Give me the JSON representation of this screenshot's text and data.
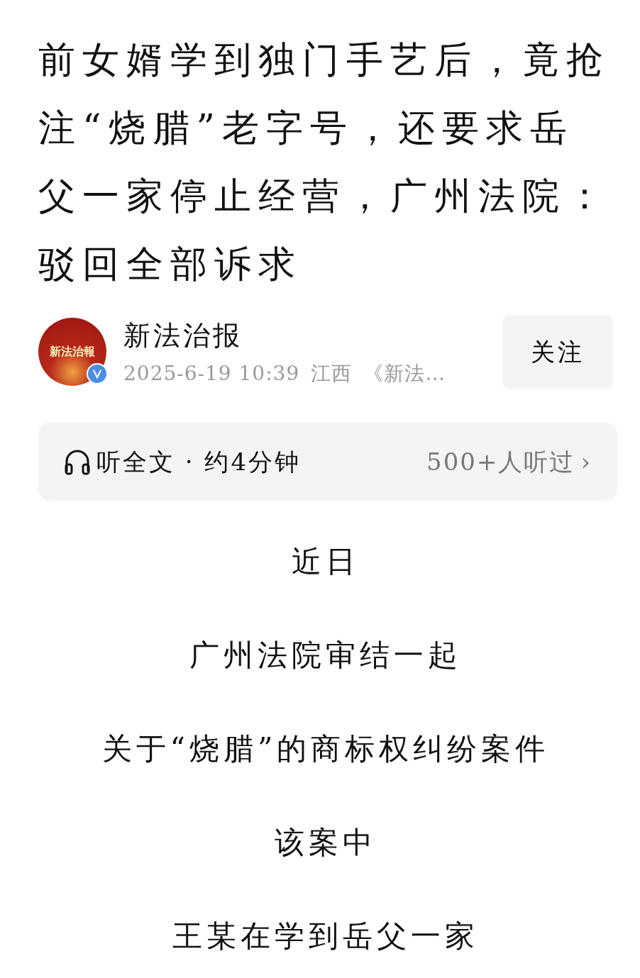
{
  "title": "前女婿学到独门手艺后，竟抢注“烧腊”老字号，还要求岳父一家停止经营，广州法院：驳回全部诉求",
  "author": {
    "avatar_text": "新法治報",
    "name": "新法治报",
    "verified": true,
    "date": "2025-6-19 10:39",
    "location": "江西",
    "source": "《新法…"
  },
  "follow_button": "关注",
  "listen_bar": {
    "label": "听全文 · 约4分钟",
    "count": "500+人听过",
    "chevron": "›"
  },
  "paragraphs": [
    "近日",
    "广州法院审结一起",
    "关于“烧腊”的商标权纠纷案件",
    "该案中",
    "王某在学到岳父一家"
  ]
}
